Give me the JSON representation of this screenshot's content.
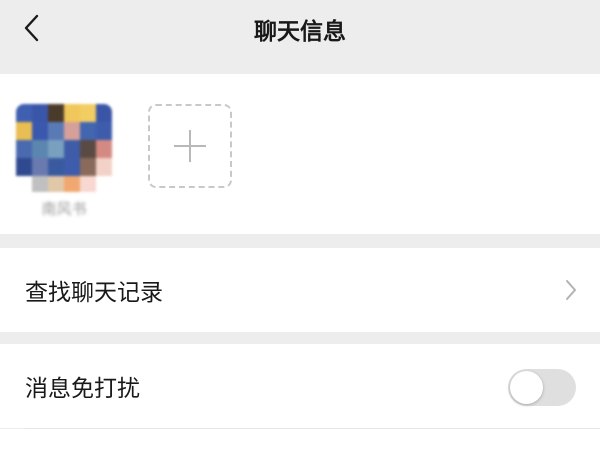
{
  "header": {
    "title": "聊天信息",
    "back_icon": "chevron-left-icon"
  },
  "members": {
    "items": [
      {
        "name": "南风书",
        "avatar_colors": [
          "#3f5fb0",
          "#3a56a8",
          "#4a3a2a",
          "#f0c75a",
          "#f2cd62",
          "#3a55a8",
          "#e9be52",
          "#3a58ad",
          "#5a7ab5",
          "#d6a09a",
          "#4266b0",
          "#3e5cac",
          "#4a6ab0",
          "#5a86b0",
          "#7aa0c0",
          "#3f5ca8",
          "#5a4a44",
          "#d48a82",
          "#2f4a90",
          "#6a7ab0",
          "#3a5aa0",
          "#3d5cab",
          "#8a6a5a",
          "#f2d2c8",
          "#ffffff",
          "#c0c0c0",
          "#e0c8a8",
          "#f0a870",
          "#f8d8d0",
          "#ffffff"
        ]
      }
    ],
    "add_icon": "plus-icon"
  },
  "rows": {
    "search_history": {
      "label": "查找聊天记录",
      "icon": "chevron-right-icon"
    },
    "mute": {
      "label": "消息免打扰",
      "enabled": false
    }
  },
  "colors": {
    "background": "#ededed",
    "card": "#ffffff",
    "toggle_off": "#dfdfdf"
  }
}
